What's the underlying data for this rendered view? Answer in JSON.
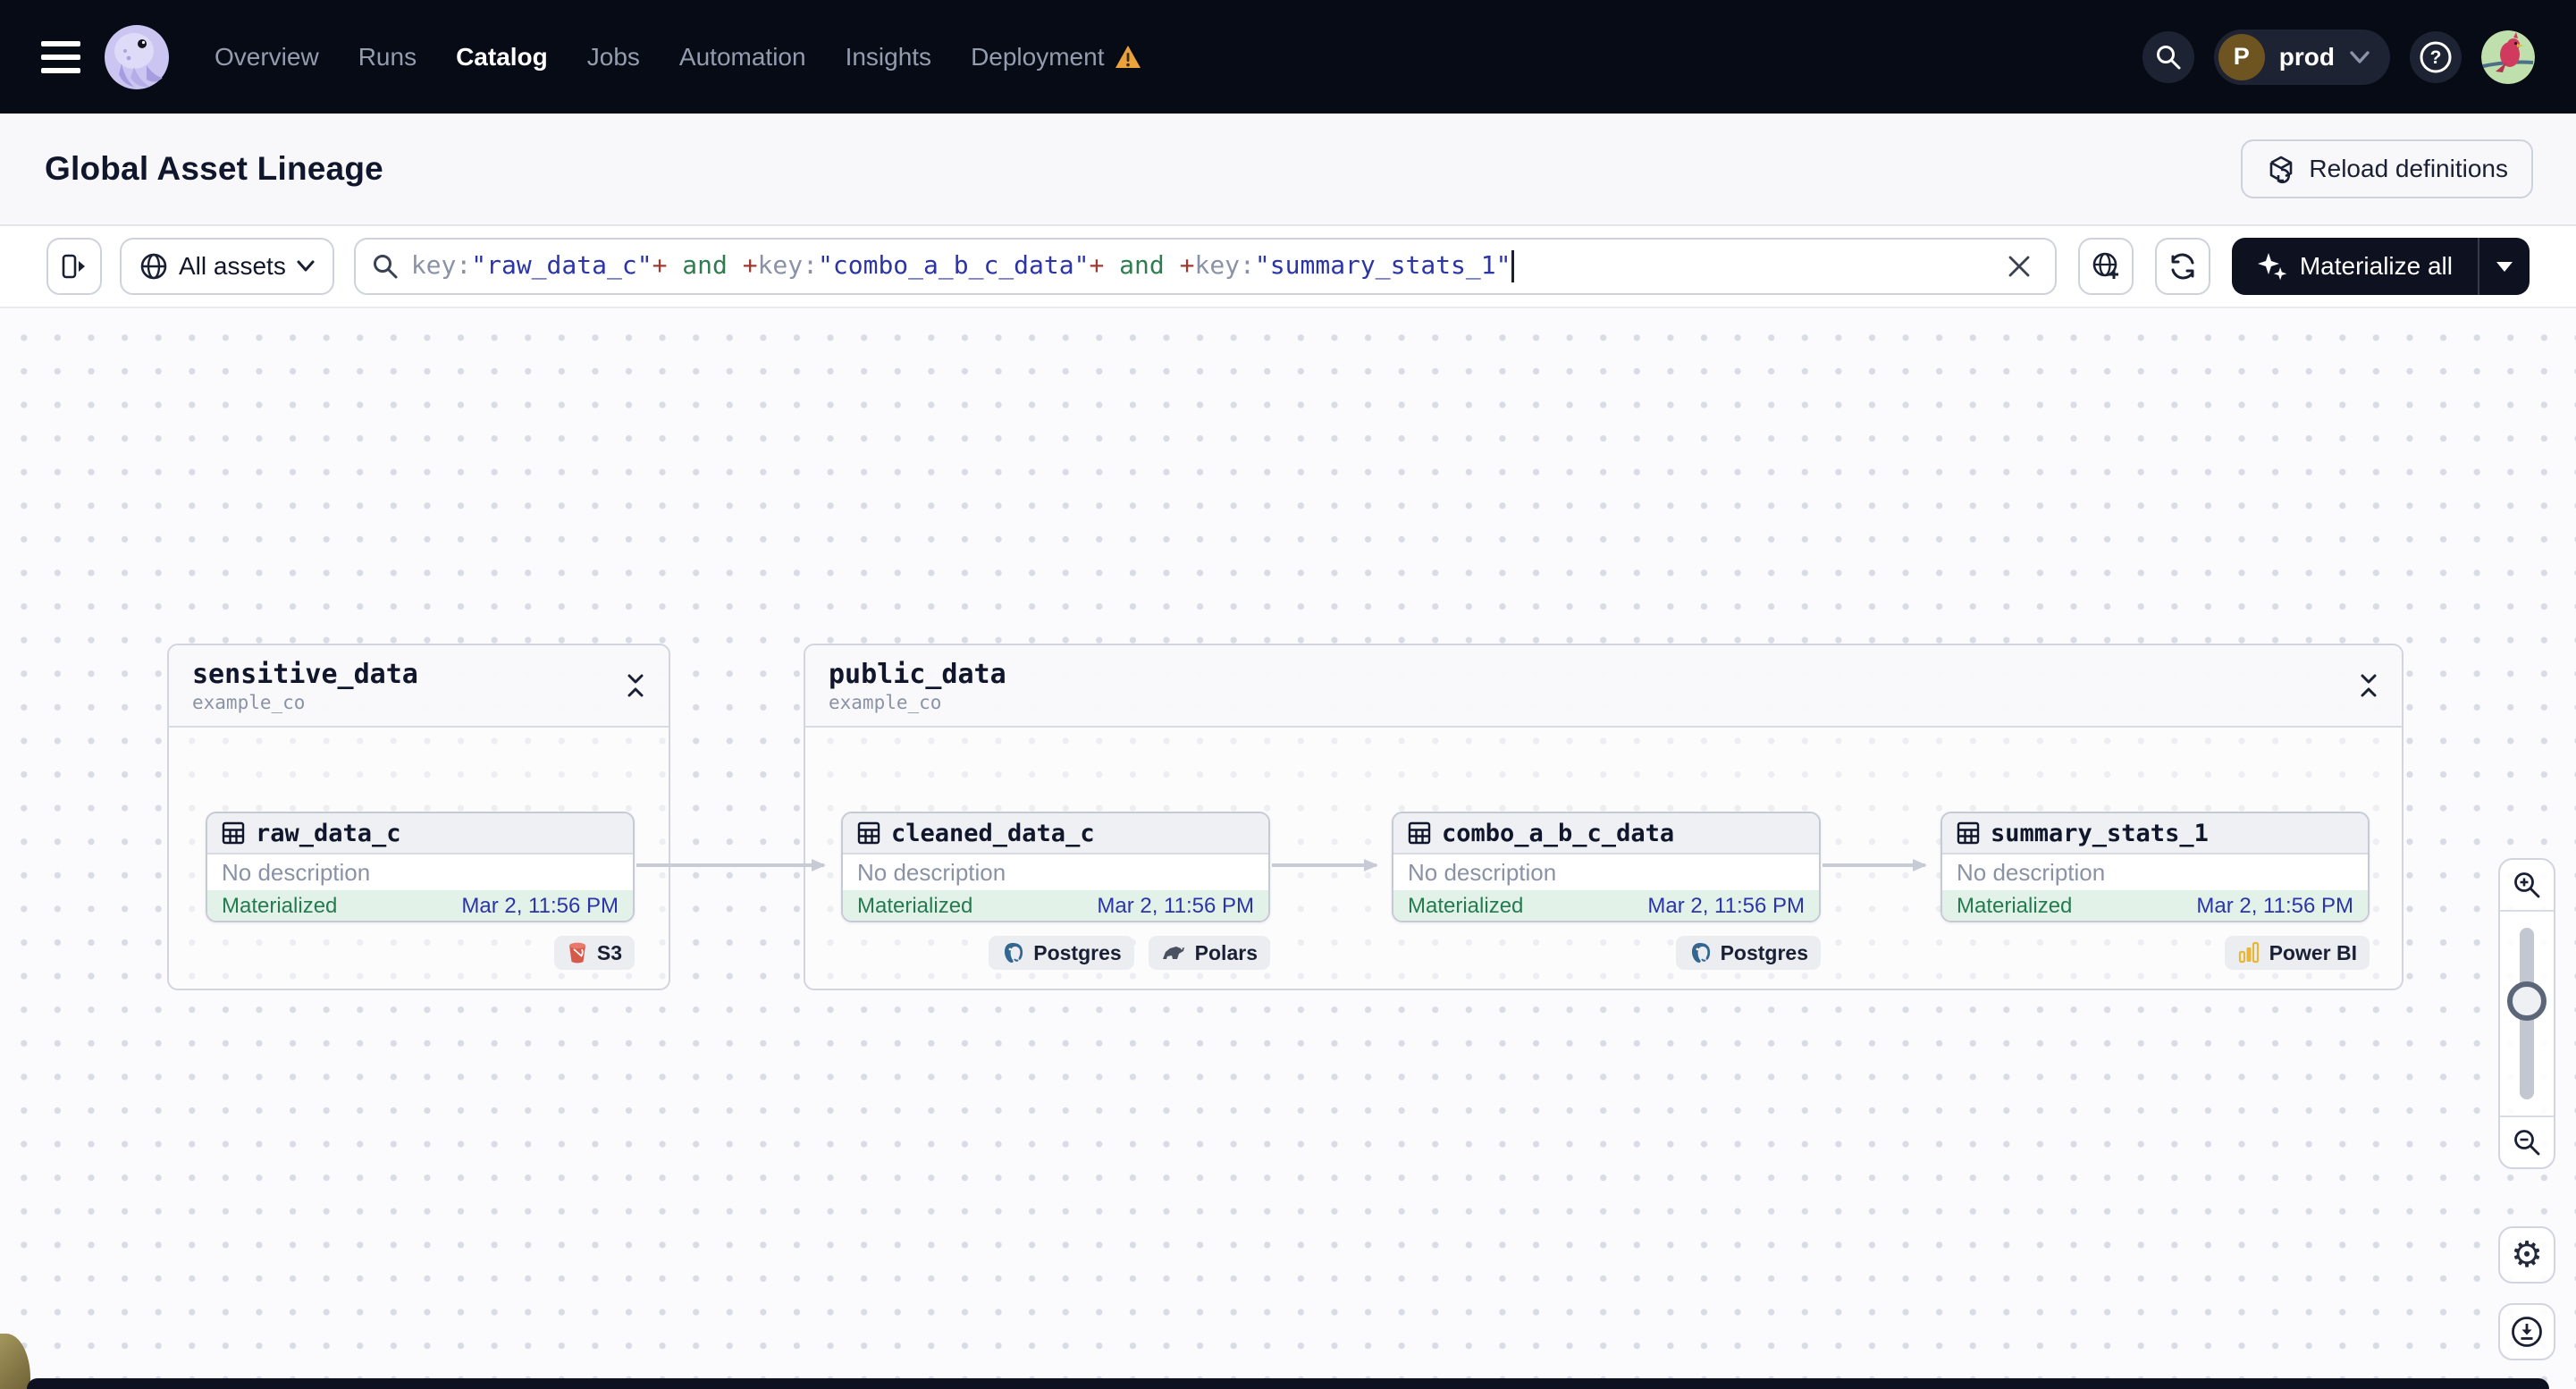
{
  "topbar": {
    "nav_items": [
      {
        "label": "Overview"
      },
      {
        "label": "Runs"
      },
      {
        "label": "Catalog"
      },
      {
        "label": "Jobs"
      },
      {
        "label": "Automation"
      },
      {
        "label": "Insights"
      },
      {
        "label": "Deployment"
      }
    ],
    "active_item": "Catalog",
    "env": {
      "label": "prod",
      "initial": "P"
    }
  },
  "page": {
    "title": "Global Asset Lineage",
    "reload_button": "Reload definitions"
  },
  "toolbar": {
    "scope": {
      "label": "All assets"
    },
    "materialize": {
      "label": "Materialize all"
    },
    "query": {
      "full": "key:\"raw_data_c\"+ and +key:\"combo_a_b_c_data\"+ and +key:\"summary_stats_1\"",
      "parts": [
        {
          "c": "key",
          "v": "key:"
        },
        {
          "c": "str",
          "v": "\"raw_data_c\""
        },
        {
          "c": "op",
          "v": "+"
        },
        {
          "c": "sp",
          "v": " "
        },
        {
          "c": "and",
          "v": "and"
        },
        {
          "c": "sp",
          "v": " "
        },
        {
          "c": "op",
          "v": "+"
        },
        {
          "c": "key",
          "v": "key:"
        },
        {
          "c": "str",
          "v": "\"combo_a_b_c_data\""
        },
        {
          "c": "op",
          "v": "+"
        },
        {
          "c": "sp",
          "v": " "
        },
        {
          "c": "and",
          "v": "and"
        },
        {
          "c": "sp",
          "v": " "
        },
        {
          "c": "op",
          "v": "+"
        },
        {
          "c": "key",
          "v": "key:"
        },
        {
          "c": "str",
          "v": "\"summary_stats_1\""
        }
      ]
    }
  },
  "graph": {
    "groups": [
      {
        "name": "sensitive_data",
        "repo": "example_co"
      },
      {
        "name": "public_data",
        "repo": "example_co"
      }
    ],
    "assets": [
      {
        "name": "raw_data_c",
        "description": "No description",
        "status": "Materialized",
        "timestamp": "Mar 2, 11:56 PM",
        "tags": [
          {
            "label": "S3"
          }
        ]
      },
      {
        "name": "cleaned_data_c",
        "description": "No description",
        "status": "Materialized",
        "timestamp": "Mar 2, 11:56 PM",
        "tags": [
          {
            "label": "Postgres"
          },
          {
            "label": "Polars"
          }
        ]
      },
      {
        "name": "combo_a_b_c_data",
        "description": "No description",
        "status": "Materialized",
        "timestamp": "Mar 2, 11:56 PM",
        "tags": [
          {
            "label": "Postgres"
          }
        ]
      },
      {
        "name": "summary_stats_1",
        "description": "No description",
        "status": "Materialized",
        "timestamp": "Mar 2, 11:56 PM",
        "tags": [
          {
            "label": "Power BI"
          }
        ]
      }
    ]
  },
  "colors": {
    "topbar_bg": "#070b16",
    "warning_orange": "#eba23b",
    "status_green": "#257a50",
    "status_bg_green": "#e3f2e8",
    "timestamp_blue": "#2b35a8",
    "query_string": "#2b35a8",
    "query_operator": "#9e3a30",
    "query_and": "#2f7d4f",
    "s3_red": "#d65a4a",
    "postgres_blue": "#336791",
    "powerbi_yellow": "#e8b73a"
  }
}
